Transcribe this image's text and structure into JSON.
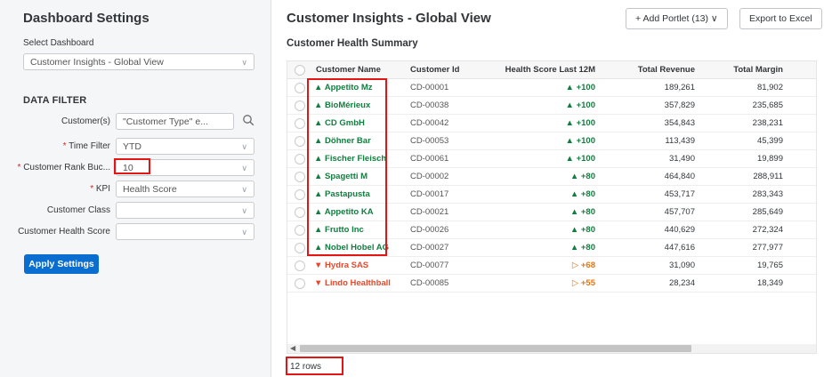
{
  "left_panel": {
    "title": "Dashboard Settings",
    "select_dashboard_label": "Select Dashboard",
    "select_dashboard_value": "Customer Insights - Global View",
    "data_filter_title": "DATA FILTER",
    "filters": {
      "customers": {
        "label": "Customer(s)",
        "value": "\"Customer Type\" e..."
      },
      "time_filter": {
        "label": "Time Filter",
        "value": "YTD"
      },
      "rank_bucket": {
        "label": "Customer Rank Buc...",
        "value": "10"
      },
      "kpi": {
        "label": "KPI",
        "value": "Health Score"
      },
      "customer_class": {
        "label": "Customer Class",
        "value": ""
      },
      "health_score": {
        "label": "Customer Health Score",
        "value": ""
      }
    },
    "apply_label": "Apply Settings"
  },
  "main": {
    "title": "Customer Insights - Global View",
    "add_portlet_label": "+  Add Portlet (13)  ∨",
    "export_label": "Export to Excel",
    "subtitle": "Customer Health Summary",
    "columns": [
      "Customer Name",
      "Customer Id",
      "Health Score Last 12M",
      "Total Revenue",
      "Total Margin"
    ],
    "rows": [
      {
        "name": "Appetito Mz",
        "id": "CD-00001",
        "score": "+100",
        "revenue": "189,261",
        "margin": "81,902",
        "trend": "up"
      },
      {
        "name": "BioMérieux",
        "id": "CD-00038",
        "score": "+100",
        "revenue": "357,829",
        "margin": "235,685",
        "trend": "up"
      },
      {
        "name": "CD GmbH",
        "id": "CD-00042",
        "score": "+100",
        "revenue": "354,843",
        "margin": "238,231",
        "trend": "up"
      },
      {
        "name": "Döhner Bar",
        "id": "CD-00053",
        "score": "+100",
        "revenue": "113,439",
        "margin": "45,399",
        "trend": "up"
      },
      {
        "name": "Fischer Fleisch",
        "id": "CD-00061",
        "score": "+100",
        "revenue": "31,490",
        "margin": "19,899",
        "trend": "up"
      },
      {
        "name": "Spagetti M",
        "id": "CD-00002",
        "score": "+80",
        "revenue": "464,840",
        "margin": "288,911",
        "trend": "up"
      },
      {
        "name": "Pastapusta",
        "id": "CD-00017",
        "score": "+80",
        "revenue": "453,717",
        "margin": "283,343",
        "trend": "up"
      },
      {
        "name": "Appetito KA",
        "id": "CD-00021",
        "score": "+80",
        "revenue": "457,707",
        "margin": "285,649",
        "trend": "up"
      },
      {
        "name": "Frutto Inc",
        "id": "CD-00026",
        "score": "+80",
        "revenue": "440,629",
        "margin": "272,324",
        "trend": "up"
      },
      {
        "name": "Nobel Hobel AG",
        "id": "CD-00027",
        "score": "+80",
        "revenue": "447,616",
        "margin": "277,977",
        "trend": "up"
      },
      {
        "name": "Hydra SAS",
        "id": "CD-00077",
        "score": "+68",
        "revenue": "31,090",
        "margin": "19,765",
        "trend": "down"
      },
      {
        "name": "Lindo Healthball",
        "id": "CD-00085",
        "score": "+55",
        "revenue": "28,234",
        "margin": "18,349",
        "trend": "down"
      }
    ],
    "row_count": "12 rows"
  },
  "colors": {
    "green": "#107e3e",
    "red": "#e9472b",
    "orange": "#e9730c",
    "accent": "#0a6ed1",
    "highlight": "#e41515"
  }
}
